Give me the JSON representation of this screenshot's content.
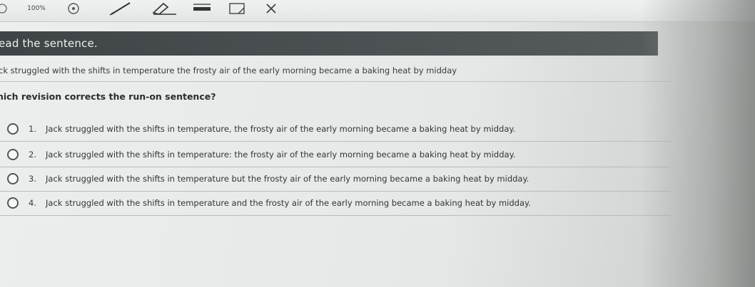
{
  "toolbar": {
    "zoom": "100%",
    "icons": [
      "back-arrow-icon",
      "info-icon",
      "pen-icon",
      "eraser-icon",
      "highlighter-icon",
      "note-icon",
      "x-icon"
    ]
  },
  "header": {
    "title": "ead the sentence."
  },
  "sentence": {
    "text": "ck struggled with the shifts in temperature the frosty air of the early morning became a baking heat by midday"
  },
  "question": {
    "text": "hich revision corrects the run-on sentence?"
  },
  "options": [
    {
      "number": "1.",
      "text": "Jack struggled with the shifts in temperature, the frosty air of the early morning became a baking heat by midday."
    },
    {
      "number": "2.",
      "text": "Jack struggled with the shifts in temperature: the frosty air of the early morning became a baking heat by midday."
    },
    {
      "number": "3.",
      "text": "Jack struggled with the shifts in temperature but the frosty air of the early morning became a baking heat by midday."
    },
    {
      "number": "4.",
      "text": "Jack struggled with the shifts in temperature and the frosty air of the early morning became a baking heat by midday."
    }
  ],
  "colors": {
    "header_bg": "#464b4e",
    "header_text": "#eef0f0",
    "page_bg": "#e8eaea"
  }
}
